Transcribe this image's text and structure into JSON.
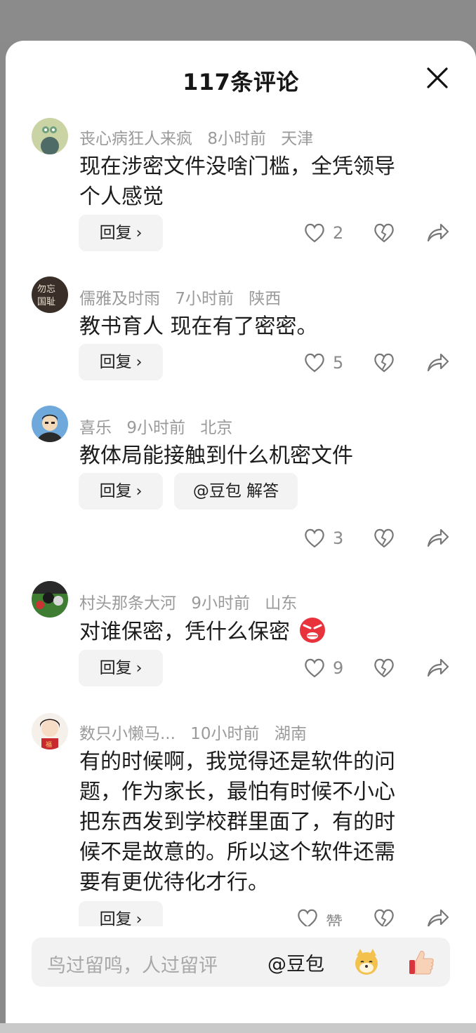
{
  "header": {
    "title": "117条评论"
  },
  "comments": [
    {
      "user": "丧心病狂人来疯",
      "time": "8小时前",
      "location": "天津",
      "text_lines": [
        "现在涉密文件没啥门槛，全凭领导",
        "个人感觉"
      ],
      "reply_label": "回复",
      "likes": "2",
      "avatar_icon": "cactus-avatar-icon"
    },
    {
      "user": "儒雅及时雨",
      "time": "7小时前",
      "location": "陕西",
      "text_lines": [
        "教书育人 现在有了密密。"
      ],
      "reply_label": "回复",
      "likes": "5",
      "avatar_icon": "calligraphy-avatar-icon"
    },
    {
      "user": "喜乐",
      "time": "9小时前",
      "location": "北京",
      "text_lines": [
        "教体局能接触到什么机密文件"
      ],
      "reply_label": "回复",
      "extra_pill": "@豆包 解答",
      "likes": "3",
      "avatar_icon": "cartoon-man-avatar-icon"
    },
    {
      "user": "村头那条大河",
      "time": "9小时前",
      "location": "山东",
      "text_lines": [
        "对谁保密，凭什么保密"
      ],
      "reply_label": "回复",
      "likes": "9",
      "avatar_icon": "billiards-avatar-icon",
      "inline_emoji": "angry-face-emoji"
    },
    {
      "user": "数只小懒马...",
      "time": "10小时前",
      "location": "湖南",
      "text_lines": [
        "有的时候啊，我觉得还是软件的问",
        "题，作为家长，最怕有时候不小心",
        "把东西发到学校群里面了，有的时",
        "候不是故意的。所以这个软件还需",
        "要有更优待化才行。"
      ],
      "reply_label": "回复",
      "likes": "赞",
      "avatar_icon": "girl-cartoon-avatar-icon"
    }
  ],
  "input": {
    "placeholder": "鸟过留鸣，人过留评",
    "at_label": "@豆包"
  },
  "colors": {
    "meta": "#9a9a9a",
    "text": "#1c1c1c",
    "pill_bg": "#f3f3f3",
    "overlay": "#8a8a8a"
  }
}
